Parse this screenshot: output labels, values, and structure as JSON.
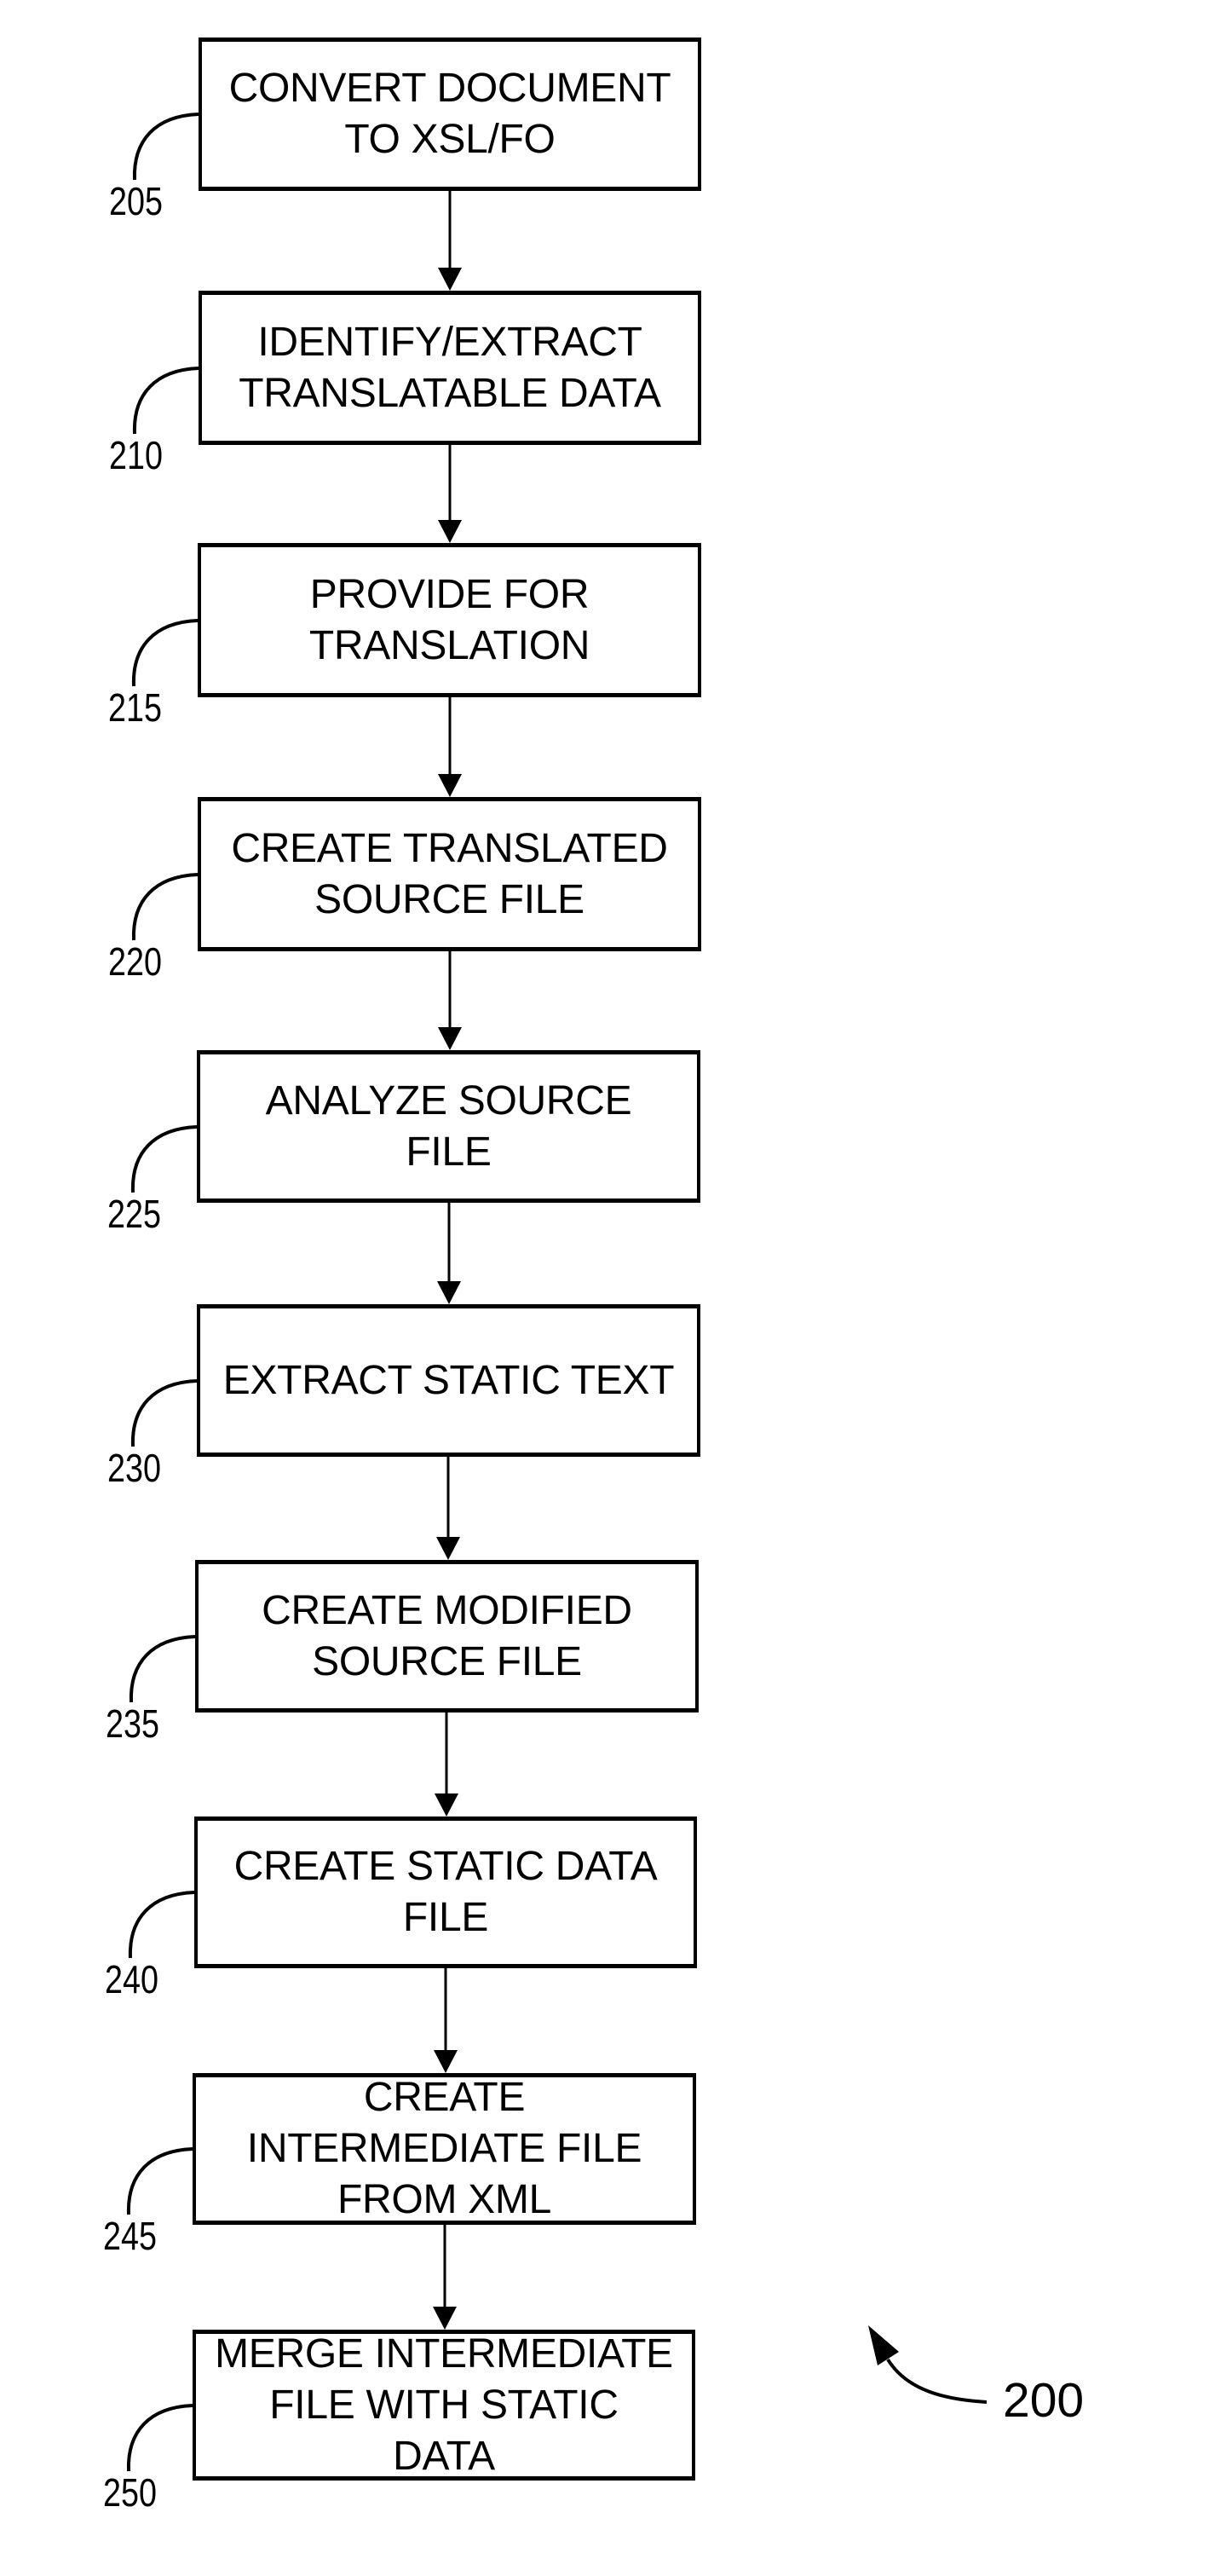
{
  "figure": {
    "reference_number": "200",
    "stroke_color": "#000000",
    "background_color": "#ffffff"
  },
  "steps": [
    {
      "ref": "205",
      "text": "CONVERT DOCUMENT\nTO XSL/FO"
    },
    {
      "ref": "210",
      "text": "IDENTIFY/EXTRACT\nTRANSLATABLE DATA"
    },
    {
      "ref": "215",
      "text": "PROVIDE FOR\nTRANSLATION"
    },
    {
      "ref": "220",
      "text": "CREATE TRANSLATED\nSOURCE FILE"
    },
    {
      "ref": "225",
      "text": "ANALYZE SOURCE\nFILE"
    },
    {
      "ref": "230",
      "text": "EXTRACT STATIC TEXT"
    },
    {
      "ref": "235",
      "text": "CREATE MODIFIED\nSOURCE FILE"
    },
    {
      "ref": "240",
      "text": "CREATE STATIC DATA\nFILE"
    },
    {
      "ref": "245",
      "text": "CREATE\nINTERMEDIATE FILE\nFROM XML"
    },
    {
      "ref": "250",
      "text": "MERGE INTERMEDIATE\nFILE WITH STATIC\nDATA"
    }
  ]
}
